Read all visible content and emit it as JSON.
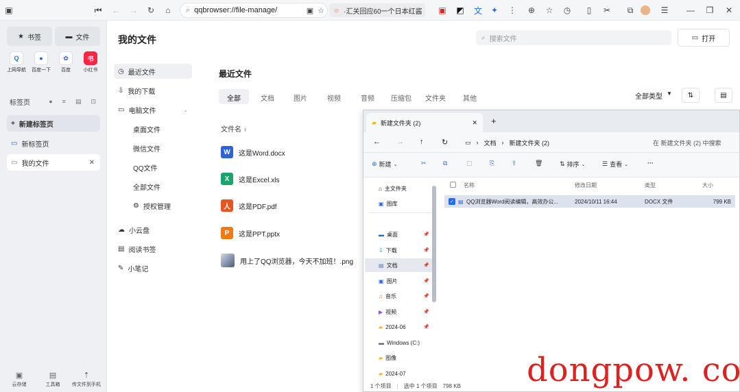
{
  "topbar": {
    "url": "qqbrowser://file-manage/",
    "news": "·汇关回应60一个日本红酱"
  },
  "sidebar": {
    "bookmarks_btn": "书签",
    "files_btn": "文件",
    "apps": [
      {
        "label": "上网导航",
        "color": "#1f6feb",
        "glyph": "Q"
      },
      {
        "label": "百度一下",
        "color": "#ffffff",
        "glyph": "●"
      },
      {
        "label": "百度",
        "color": "#ffffff",
        "glyph": "✿"
      },
      {
        "label": "小红书",
        "color": "#ff2442",
        "glyph": "书"
      }
    ],
    "tabs_header": "标签页",
    "new_tab": "新建标签页",
    "tab_new_label": "新标签页",
    "tab_files_label": "我的文件",
    "tools": [
      "云存储",
      "工具箱",
      "传文件到手机"
    ]
  },
  "main": {
    "title": "我的文件",
    "search_placeholder": "搜索文件",
    "open_btn": "打开",
    "nav": {
      "recent": "最近文件",
      "downloads": "我的下载",
      "computer": "电脑文件",
      "desktop": "桌面文件",
      "wechat": "微信文件",
      "qq": "QQ文件",
      "all": "全部文件",
      "auth": "授权管理",
      "cloud": "小云盘",
      "read": "阅读书签",
      "notes": "小笔记"
    },
    "section_title": "最近文件",
    "tabs": [
      "全部",
      "文档",
      "图片",
      "视频",
      "音频",
      "压缩包",
      "文件夹",
      "其他"
    ],
    "filter": "全部类型",
    "col_name": "文件名",
    "files": [
      {
        "name": "这是Word.docx",
        "type": "W",
        "color": "#2b64d8"
      },
      {
        "name": "这是Excel.xls",
        "type": "X",
        "color": "#1aa36a"
      },
      {
        "name": "这是PDF.pdf",
        "type": "人",
        "color": "#e8531f"
      },
      {
        "name": "这是PPT.pptx",
        "type": "P",
        "color": "#f07b14"
      },
      {
        "name": "用上了QQ浏览器，今天不加班！.png",
        "type": "img",
        "color": "#8fa3c4"
      }
    ]
  },
  "explorer": {
    "tab_title": "新建文件夹 (2)",
    "breadcrumb": [
      "文档",
      "新建文件夹 (2)"
    ],
    "search": "在 新建文件夹 (2) 中搜索",
    "toolbar": {
      "new": "新建",
      "sort": "排序",
      "view": "查看"
    },
    "tree": [
      {
        "label": "主文件夹",
        "pin": false
      },
      {
        "label": "图库",
        "pin": false
      },
      {
        "label": "桌面",
        "pin": true
      },
      {
        "label": "下载",
        "pin": true
      },
      {
        "label": "文档",
        "pin": true
      },
      {
        "label": "图片",
        "pin": true
      },
      {
        "label": "音乐",
        "pin": true
      },
      {
        "label": "视频",
        "pin": true
      },
      {
        "label": "2024-06",
        "pin": true
      },
      {
        "label": "Windows (C:)",
        "pin": false
      },
      {
        "label": "图像",
        "pin": false
      },
      {
        "label": "2024-07",
        "pin": false
      }
    ],
    "columns": [
      "名称",
      "修改日期",
      "类型",
      "大小"
    ],
    "rows": [
      {
        "name": "QQ浏览器Word阅读编辑，高效办公...",
        "date": "2024/10/11 16:44",
        "type": "DOCX 文件",
        "size": "799 KB"
      }
    ],
    "status": {
      "count": "1 个项目",
      "selected": "选中 1 个项目",
      "size": "798 KB"
    }
  },
  "watermark": "dongpow. com"
}
